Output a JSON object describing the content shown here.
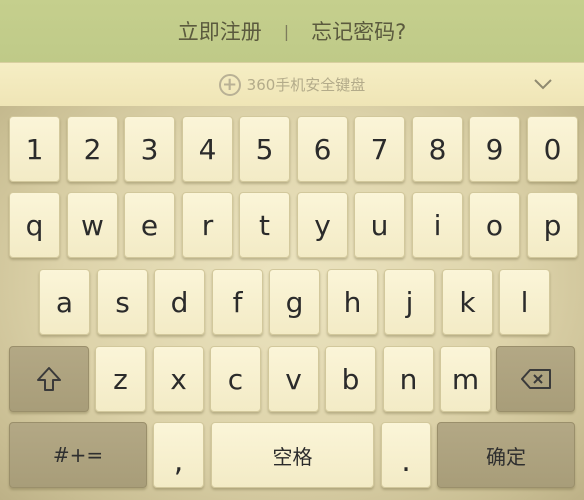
{
  "top_bar": {
    "register_label": "立即注册",
    "separator": "|",
    "forgot_label": "忘记密码?"
  },
  "keyboard_header": {
    "brand_label": "360手机安全键盘",
    "brand_icon": "plus-circle-icon",
    "collapse_icon": "chevron-down-icon"
  },
  "keys": {
    "numbers": [
      "1",
      "2",
      "3",
      "4",
      "5",
      "6",
      "7",
      "8",
      "9",
      "0"
    ],
    "row1": [
      "q",
      "w",
      "e",
      "r",
      "t",
      "y",
      "u",
      "i",
      "o",
      "p"
    ],
    "row2": [
      "a",
      "s",
      "d",
      "f",
      "g",
      "h",
      "j",
      "k",
      "l"
    ],
    "row3": [
      "z",
      "x",
      "c",
      "v",
      "b",
      "n",
      "m"
    ],
    "shift_icon": "shift-arrow-icon",
    "backspace_icon": "backspace-icon",
    "symbols_label": "#+=",
    "comma_label": ",",
    "space_label": "空格",
    "period_label": ".",
    "confirm_label": "确定"
  },
  "colors": {
    "top_bar_bg": "#c5cf8d",
    "header_bg": "#f6eec4",
    "key_bg": "#f8f1cf",
    "dark_key_bg": "#afa480"
  }
}
